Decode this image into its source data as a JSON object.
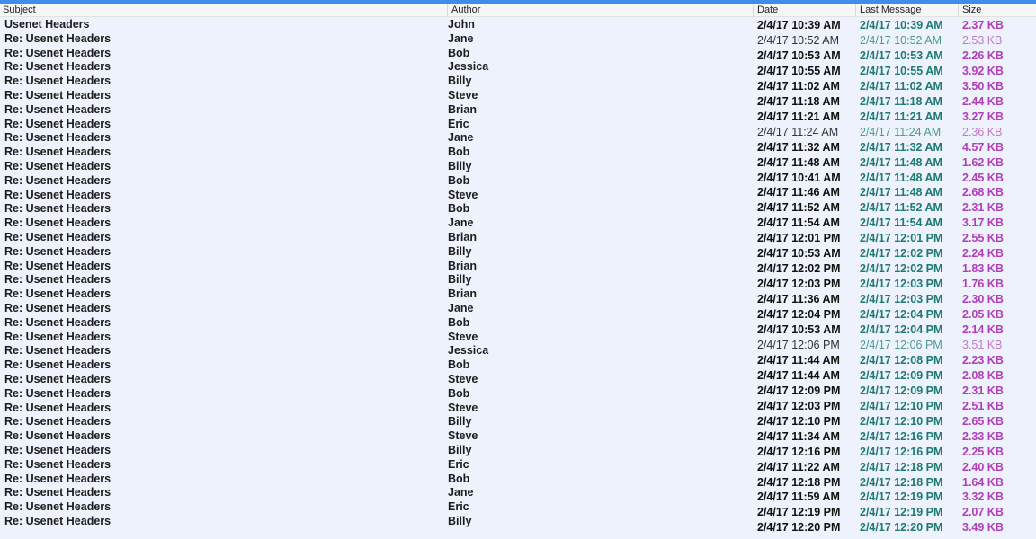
{
  "columns": {
    "subject": "Subject",
    "author": "Author",
    "date": "Date",
    "last_message": "Last Message",
    "size": "Size"
  },
  "subjects": [
    "Usenet Headers",
    "Re: Usenet Headers",
    "Re: Usenet Headers",
    "Re: Usenet Headers",
    "Re: Usenet Headers",
    "Re: Usenet Headers",
    "Re: Usenet Headers",
    "Re: Usenet Headers",
    "Re: Usenet Headers",
    "Re: Usenet Headers",
    "Re: Usenet Headers",
    "Re: Usenet Headers",
    "Re: Usenet Headers",
    "Re: Usenet Headers",
    "Re: Usenet Headers",
    "Re: Usenet Headers",
    "Re: Usenet Headers",
    "Re: Usenet Headers",
    "Re: Usenet Headers",
    "Re: Usenet Headers",
    "Re: Usenet Headers",
    "Re: Usenet Headers",
    "Re: Usenet Headers",
    "Re: Usenet Headers",
    "Re: Usenet Headers",
    "Re: Usenet Headers",
    "Re: Usenet Headers",
    "Re: Usenet Headers",
    "Re: Usenet Headers",
    "Re: Usenet Headers",
    "Re: Usenet Headers",
    "Re: Usenet Headers",
    "Re: Usenet Headers",
    "Re: Usenet Headers",
    "Re: Usenet Headers",
    "Re: Usenet Headers"
  ],
  "authors": [
    "John",
    "Jane",
    "Bob",
    "Jessica",
    "Billy",
    "Steve",
    "Brian",
    "Eric",
    "Jane",
    "Bob",
    "Billy",
    "Bob",
    "Steve",
    "Bob",
    "Jane",
    "Brian",
    "Billy",
    "Brian",
    "Billy",
    "Brian",
    "Jane",
    "Bob",
    "Steve",
    "Jessica",
    "Bob",
    "Steve",
    "Bob",
    "Steve",
    "Billy",
    "Steve",
    "Billy",
    "Eric",
    "Bob",
    "Jane",
    "Eric",
    "Billy"
  ],
  "messages": [
    {
      "date": "2/4/17 10:39 AM",
      "last": "2/4/17 10:39 AM",
      "size": "2.37 KB",
      "read": false
    },
    {
      "date": "2/4/17 10:52 AM",
      "last": "2/4/17 10:52 AM",
      "size": "2.53 KB",
      "read": true
    },
    {
      "date": "2/4/17 10:53 AM",
      "last": "2/4/17 10:53 AM",
      "size": "2.26 KB",
      "read": false
    },
    {
      "date": "2/4/17 10:55 AM",
      "last": "2/4/17 10:55 AM",
      "size": "3.92 KB",
      "read": false
    },
    {
      "date": "2/4/17 11:02 AM",
      "last": "2/4/17 11:02 AM",
      "size": "3.50 KB",
      "read": false
    },
    {
      "date": "2/4/17 11:18 AM",
      "last": "2/4/17 11:18 AM",
      "size": "2.44 KB",
      "read": false
    },
    {
      "date": "2/4/17 11:21 AM",
      "last": "2/4/17 11:21 AM",
      "size": "3.27 KB",
      "read": false
    },
    {
      "date": "2/4/17 11:24 AM",
      "last": "2/4/17 11:24 AM",
      "size": "2.36 KB",
      "read": true
    },
    {
      "date": "2/4/17 11:32 AM",
      "last": "2/4/17 11:32 AM",
      "size": "4.57 KB",
      "read": false
    },
    {
      "date": "2/4/17 11:48 AM",
      "last": "2/4/17 11:48 AM",
      "size": "1.62 KB",
      "read": false
    },
    {
      "date": "2/4/17 10:41 AM",
      "last": "2/4/17 11:48 AM",
      "size": "2.45 KB",
      "read": false
    },
    {
      "date": "2/4/17 11:46 AM",
      "last": "2/4/17 11:48 AM",
      "size": "2.68 KB",
      "read": false
    },
    {
      "date": "2/4/17 11:52 AM",
      "last": "2/4/17 11:52 AM",
      "size": "2.31 KB",
      "read": false
    },
    {
      "date": "2/4/17 11:54 AM",
      "last": "2/4/17 11:54 AM",
      "size": "3.17 KB",
      "read": false
    },
    {
      "date": "2/4/17 12:01 PM",
      "last": "2/4/17 12:01 PM",
      "size": "2.55 KB",
      "read": false
    },
    {
      "date": "2/4/17 10:53 AM",
      "last": "2/4/17 12:02 PM",
      "size": "2.24 KB",
      "read": false
    },
    {
      "date": "2/4/17 12:02 PM",
      "last": "2/4/17 12:02 PM",
      "size": "1.83 KB",
      "read": false
    },
    {
      "date": "2/4/17 12:03 PM",
      "last": "2/4/17 12:03 PM",
      "size": "1.76 KB",
      "read": false
    },
    {
      "date": "2/4/17 11:36 AM",
      "last": "2/4/17 12:03 PM",
      "size": "2.30 KB",
      "read": false
    },
    {
      "date": "2/4/17 12:04 PM",
      "last": "2/4/17 12:04 PM",
      "size": "2.05 KB",
      "read": false
    },
    {
      "date": "2/4/17 10:53 AM",
      "last": "2/4/17 12:04 PM",
      "size": "2.14 KB",
      "read": false
    },
    {
      "date": "2/4/17 12:06 PM",
      "last": "2/4/17 12:06 PM",
      "size": "3.51 KB",
      "read": true
    },
    {
      "date": "2/4/17 11:44 AM",
      "last": "2/4/17 12:08 PM",
      "size": "2.23 KB",
      "read": false
    },
    {
      "date": "2/4/17 11:44 AM",
      "last": "2/4/17 12:09 PM",
      "size": "2.08 KB",
      "read": false
    },
    {
      "date": "2/4/17 12:09 PM",
      "last": "2/4/17 12:09 PM",
      "size": "2.31 KB",
      "read": false
    },
    {
      "date": "2/4/17 12:03 PM",
      "last": "2/4/17 12:10 PM",
      "size": "2.51 KB",
      "read": false
    },
    {
      "date": "2/4/17 12:10 PM",
      "last": "2/4/17 12:10 PM",
      "size": "2.65 KB",
      "read": false
    },
    {
      "date": "2/4/17 11:34 AM",
      "last": "2/4/17 12:16 PM",
      "size": "2.33 KB",
      "read": false
    },
    {
      "date": "2/4/17 12:16 PM",
      "last": "2/4/17 12:16 PM",
      "size": "2.25 KB",
      "read": false
    },
    {
      "date": "2/4/17 11:22 AM",
      "last": "2/4/17 12:18 PM",
      "size": "2.40 KB",
      "read": false
    },
    {
      "date": "2/4/17 12:18 PM",
      "last": "2/4/17 12:18 PM",
      "size": "1.64 KB",
      "read": false
    },
    {
      "date": "2/4/17 11:59 AM",
      "last": "2/4/17 12:19 PM",
      "size": "3.32 KB",
      "read": false
    },
    {
      "date": "2/4/17 12:19 PM",
      "last": "2/4/17 12:19 PM",
      "size": "2.07 KB",
      "read": false
    },
    {
      "date": "2/4/17 12:20 PM",
      "last": "2/4/17 12:20 PM",
      "size": "3.49 KB",
      "read": false
    }
  ]
}
